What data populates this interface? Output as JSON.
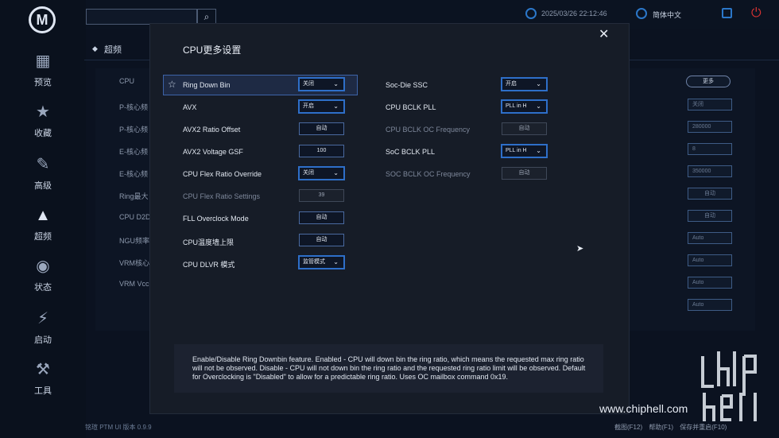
{
  "nav": [
    {
      "label": "预览",
      "icon": "grid-icon"
    },
    {
      "label": "收藏",
      "icon": "star-icon"
    },
    {
      "label": "高级",
      "icon": "wrench-icon"
    },
    {
      "label": "超频",
      "icon": "rocket-icon"
    },
    {
      "label": "状态",
      "icon": "gauge-icon"
    },
    {
      "label": "启动",
      "icon": "ssd-icon"
    },
    {
      "label": "工具",
      "icon": "hammer-icon"
    }
  ],
  "topbar": {
    "search_placeholder": "",
    "datetime": "2025/03/26 22:12:46",
    "language": "简体中文"
  },
  "page": {
    "section_title": "超频",
    "more_button": "更多",
    "rows": [
      "CPU",
      "P-核心频",
      "P-核心频",
      "E-核心频",
      "E-核心频",
      "Ring最大",
      "CPU D2D",
      "NGU频率",
      "VRM核心",
      "VRM Vcc"
    ],
    "controls": [
      "关闭",
      "280000",
      "8",
      "350000",
      "自动",
      "自动",
      "Auto",
      "Auto",
      "Auto",
      "Auto"
    ]
  },
  "modal": {
    "title": "CPU更多设置",
    "left_options": [
      {
        "label": "Ring Down Bin",
        "value": "关闭",
        "type": "drop"
      },
      {
        "label": "AVX",
        "value": "开启",
        "type": "drop"
      },
      {
        "label": "AVX2 Ratio Offset",
        "value": "自动",
        "type": "text"
      },
      {
        "label": "AVX2 Voltage GSF",
        "value": "100",
        "type": "text"
      },
      {
        "label": "CPU Flex Ratio Override",
        "value": "关闭",
        "type": "drop"
      },
      {
        "label": "CPU Flex Ratio Settings",
        "value": "39",
        "type": "disabled"
      },
      {
        "label": "FLL Overclock Mode",
        "value": "自动",
        "type": "text"
      },
      {
        "label": "CPU温度墙上限",
        "value": "自动",
        "type": "text"
      },
      {
        "label": "CPU DLVR 模式",
        "value": "监管模式",
        "type": "drop"
      }
    ],
    "right_options": [
      {
        "label": "Soc-Die SSC",
        "value": "开启",
        "type": "drop"
      },
      {
        "label": "CPU BCLK PLL",
        "value": "PLL in H",
        "type": "drop"
      },
      {
        "label": "CPU BCLK OC Frequency",
        "value": "自动",
        "type": "disabled"
      },
      {
        "label": "SoC BCLK PLL",
        "value": "PLL in H",
        "type": "drop"
      },
      {
        "label": "SOC BCLK OC Frequency",
        "value": "自动",
        "type": "disabled"
      }
    ],
    "description": "Enable/Disable Ring Downbin feature. Enabled - CPU will down bin the ring ratio, which means the requested max ring ratio will not be observed. Disable - CPU will not down bin the ring ratio and the requested ring ratio limit will be observed. Default for Overclocking is \"Disabled\" to allow for a predictable ring ratio. Uses OC mailbox command 0x19."
  },
  "footer": {
    "version": "铭瑄 PTM UI 版本 0.9.9",
    "actions": "截图(F12) 帮助(F1) 保存并重启(F10)"
  },
  "watermark": "www.chiphell.com",
  "colors": {
    "accent": "#2e6fc9",
    "power": "#d43232"
  }
}
